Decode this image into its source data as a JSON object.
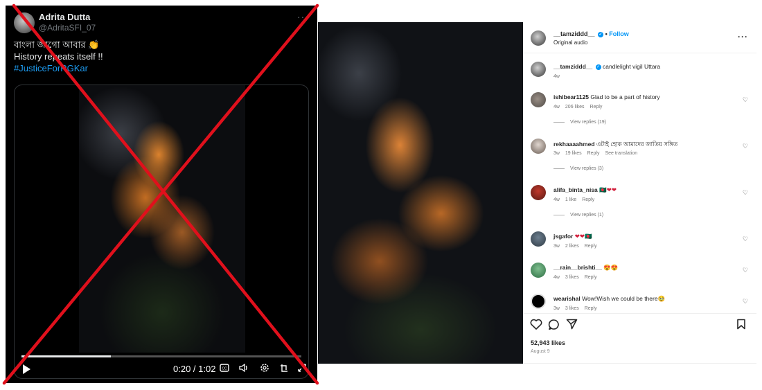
{
  "tweet": {
    "author_name": "Adrita Dutta",
    "handle": "@AdritaSFI_07",
    "text_line1": "বাংলা জাগো আবার 👏",
    "text_line2": "History repeats itself !!",
    "hashtag": "#JusticeForRGKar",
    "video": {
      "time": "0:20 / 1:02",
      "progress": 0.32
    },
    "control_icons": [
      "captions-icon",
      "volume-icon",
      "settings-icon",
      "pip-icon",
      "fullscreen-icon"
    ]
  },
  "instagram": {
    "header": {
      "username": "__tamziddd__",
      "follow": "Follow",
      "audio": "Original audio"
    },
    "caption": {
      "username": "__tamziddd__",
      "text": "candlelight vigil Uttara",
      "age": "4w"
    },
    "comments": [
      {
        "username": "ishibear1125",
        "text": "Glad to be a part of history",
        "age": "4w",
        "likes": "206 likes",
        "reply": "Reply",
        "extra": "",
        "replies": "View replies (19)"
      },
      {
        "username": "rekhaaaahmed",
        "text": "এটাই হোক আমাদের জাতিয় সঙ্গিত",
        "age": "3w",
        "likes": "19 likes",
        "reply": "Reply",
        "extra": "See translation",
        "replies": "View replies (3)"
      },
      {
        "username": "alifa_binta_nisa",
        "text": "🇧🇩❤❤",
        "age": "4w",
        "likes": "1 like",
        "reply": "Reply",
        "extra": "",
        "replies": "View replies (1)"
      },
      {
        "username": "jsgafor",
        "text": "❤❤🇧🇩",
        "age": "3w",
        "likes": "2 likes",
        "reply": "Reply",
        "extra": "",
        "replies": ""
      },
      {
        "username": "__rain__brishti__",
        "text": "😍😍",
        "age": "4w",
        "likes": "3 likes",
        "reply": "Reply",
        "extra": "",
        "replies": ""
      },
      {
        "username": "wearishal",
        "text": "Wow!Wish we could be there🥹",
        "age": "3w",
        "likes": "3 likes",
        "reply": "Reply",
        "extra": "",
        "replies": ""
      }
    ],
    "likes_count": "52,943 likes",
    "date": "August 9"
  }
}
